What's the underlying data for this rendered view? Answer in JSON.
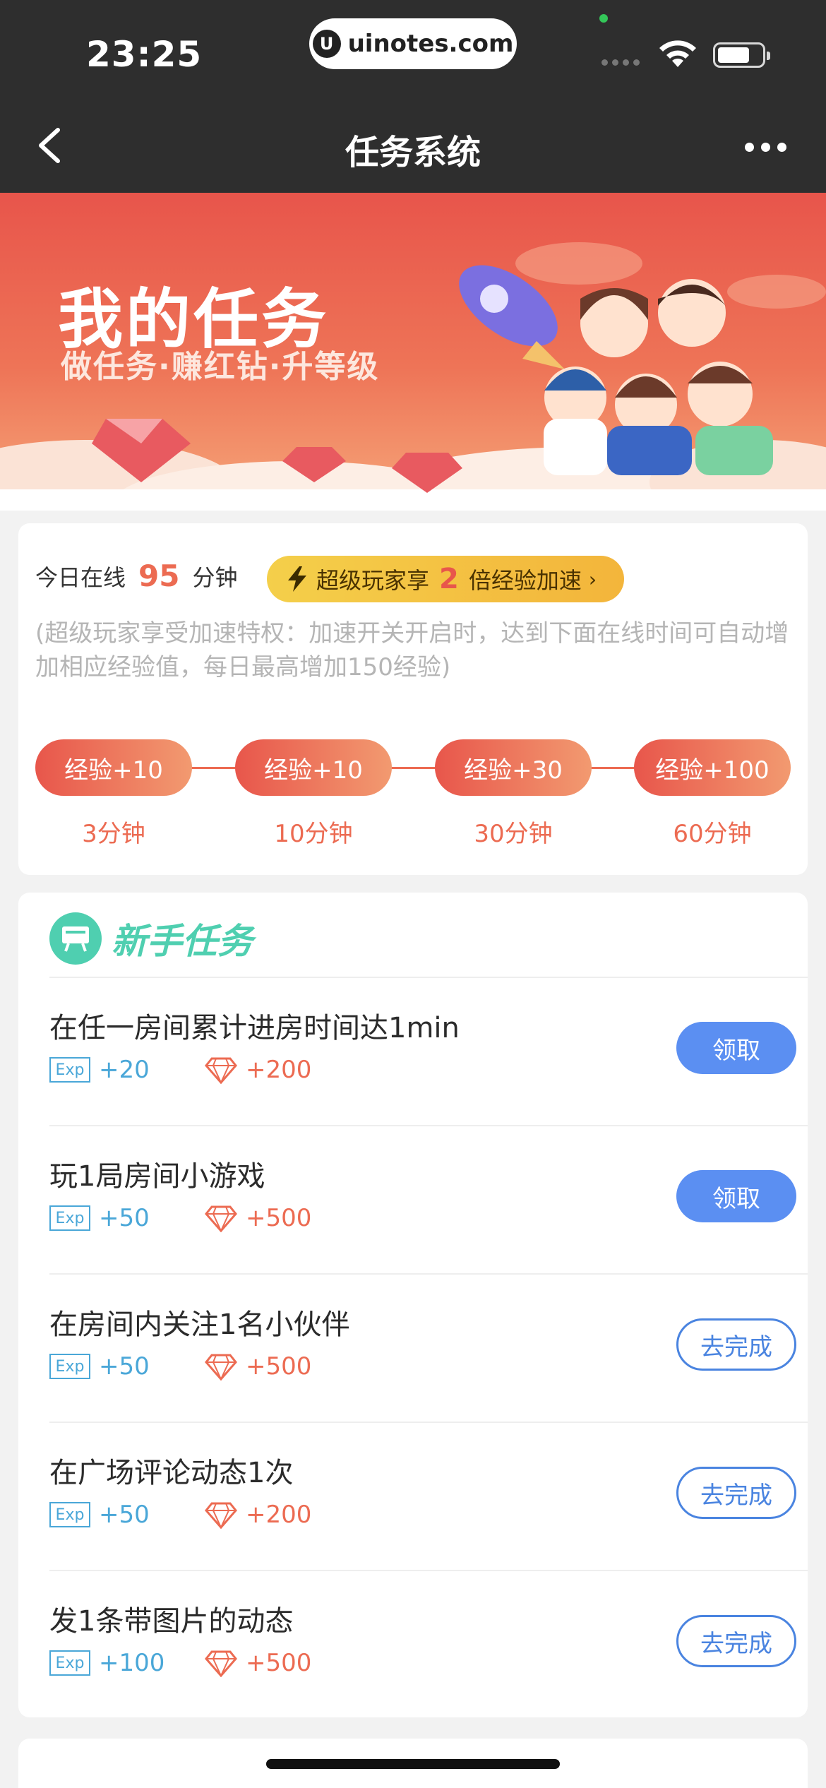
{
  "status_bar": {
    "time": "23:25",
    "url": "uinotes.com",
    "url_logo": "U"
  },
  "nav": {
    "title": "任务系统",
    "back_icon": "chevron-left-icon",
    "more_icon": "more-horizontal-icon"
  },
  "banner": {
    "title": "我的任务",
    "subtitle": "做任务·赚红钻·升等级"
  },
  "online": {
    "label": "今日在线",
    "minutes": "95",
    "unit": "分钟",
    "boost_prefix": "超级玩家享",
    "boost_multiplier": "2",
    "boost_suffix": "倍经验加速",
    "boost_arrow": "›",
    "note": "(超级玩家享受加速特权：加速开关开启时，达到下面在线时间可自动增加相应经验值，每日最高增加150经验)",
    "steps": [
      {
        "reward": "经验+10",
        "time": "3分钟"
      },
      {
        "reward": "经验+10",
        "time": "10分钟"
      },
      {
        "reward": "经验+30",
        "time": "30分钟"
      },
      {
        "reward": "经验+100",
        "time": "60分钟"
      }
    ]
  },
  "tasks": {
    "title": "新手任务",
    "exp_badge": "Exp",
    "items": [
      {
        "name": "在任一房间累计进房时间达1min",
        "exp": "+20",
        "gems": "+200",
        "action": "领取",
        "state": "claim"
      },
      {
        "name": "玩1局房间小游戏",
        "exp": "+50",
        "gems": "+500",
        "action": "领取",
        "state": "claim"
      },
      {
        "name": "在房间内关注1名小伙伴",
        "exp": "+50",
        "gems": "+500",
        "action": "去完成",
        "state": "todo"
      },
      {
        "name": "在广场评论动态1次",
        "exp": "+50",
        "gems": "+200",
        "action": "去完成",
        "state": "todo"
      },
      {
        "name": "发1条带图片的动态",
        "exp": "+100",
        "gems": "+500",
        "action": "去完成",
        "state": "todo"
      }
    ]
  },
  "colors": {
    "accent_red": "#ec6b52",
    "accent_green": "#4fcfb0",
    "accent_blue": "#5b8ff2",
    "exp_blue": "#4aa7d8",
    "boost_yellow": "#f4cf4a"
  }
}
